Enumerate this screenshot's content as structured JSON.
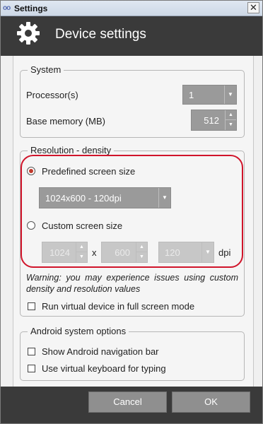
{
  "window": {
    "title": "Settings",
    "close_symbol": "✕",
    "app_icon_text": "oo"
  },
  "header": {
    "title": "Device settings"
  },
  "system": {
    "legend": "System",
    "processor_label": "Processor(s)",
    "processor_value": "1",
    "memory_label": "Base memory (MB)",
    "memory_value": "512"
  },
  "resolution": {
    "legend": "Resolution - density",
    "predefined_label": "Predefined screen size",
    "predefined_checked": true,
    "predefined_value": "1024x600 - 120dpi",
    "custom_label": "Custom screen size",
    "custom_checked": false,
    "width_value": "1024",
    "x_label": "x",
    "height_value": "600",
    "dpi_value": "120",
    "dpi_label": "dpi",
    "warning": "Warning: you may experience issues using custom density and resolution values",
    "fullscreen_label": "Run virtual device in full screen mode",
    "fullscreen_checked": false
  },
  "android": {
    "legend": "Android system options",
    "navbar_label": "Show Android navigation bar",
    "navbar_checked": false,
    "keyboard_label": "Use virtual keyboard for typing",
    "keyboard_checked": false
  },
  "footer": {
    "cancel_label": "Cancel",
    "ok_label": "OK"
  },
  "colors": {
    "accent_red": "#d0142a",
    "header_bg": "#3a3a3a",
    "control_bg": "#9a9a9a"
  }
}
